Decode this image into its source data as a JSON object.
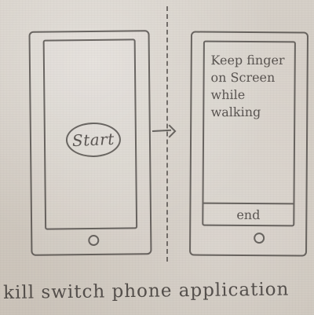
{
  "screens": {
    "left": {
      "start_label": "Start"
    },
    "right": {
      "instruction_lines": [
        "Keep finger",
        "on Screen",
        "while",
        "walking"
      ],
      "end_label": "end"
    }
  },
  "caption": "kill switch phone application",
  "icons": {
    "arrow": "arrow-right-icon",
    "home_button": "home-button-icon"
  },
  "colors": {
    "paper": "#cfc7bd",
    "pencil": "#3f3c3a"
  }
}
